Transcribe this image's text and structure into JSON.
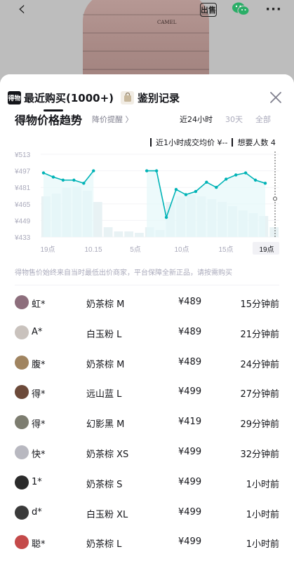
{
  "backdrop": {
    "jacket_logo": "CAMEL",
    "sell_badge": "出售"
  },
  "tabs": [
    {
      "label": "最近购买(1000+)",
      "icon": "dewu-logo-icon",
      "icon_text": "得物"
    },
    {
      "label": "鉴别记录",
      "icon": "shopping-bag-icon"
    }
  ],
  "trend": {
    "title": "得物价格趋势",
    "alert": "降价提醒 〉",
    "ranges": [
      "近24小时",
      "30天",
      "全部"
    ]
  },
  "info": {
    "last_hour": "近1小时成交均价 ¥--",
    "wanted": "想要人数 4"
  },
  "chart_data": {
    "type": "line",
    "y_ticks": [
      "¥513",
      "¥497",
      "¥481",
      "¥465",
      "¥449",
      "¥433"
    ],
    "x_ticks": [
      "19点",
      "10.15",
      "5点",
      "10点",
      "15点",
      "19点"
    ],
    "ylim": [
      433,
      513
    ],
    "price_series": [
      {
        "x": 0.0,
        "y": 495
      },
      {
        "x": 0.9,
        "y": 491
      },
      {
        "x": 1.8,
        "y": 488
      },
      {
        "x": 2.8,
        "y": 488
      },
      {
        "x": 3.7,
        "y": 485
      },
      {
        "x": 4.6,
        "y": 497
      },
      {
        "x": 9.5,
        "y": 497
      },
      {
        "x": 10.4,
        "y": 497
      },
      {
        "x": 11.3,
        "y": 452
      },
      {
        "x": 12.2,
        "y": 479
      },
      {
        "x": 13.1,
        "y": 474
      },
      {
        "x": 14.0,
        "y": 477
      },
      {
        "x": 15.0,
        "y": 486
      },
      {
        "x": 15.9,
        "y": 481
      },
      {
        "x": 16.8,
        "y": 489
      },
      {
        "x": 17.7,
        "y": 493
      },
      {
        "x": 18.6,
        "y": 495
      },
      {
        "x": 19.5,
        "y": 488
      },
      {
        "x": 20.4,
        "y": 485
      }
    ],
    "volume_bars": [
      58,
      62,
      70,
      72,
      66,
      50,
      14,
      8,
      8,
      6,
      14,
      10,
      50,
      58,
      60,
      58,
      54,
      50,
      44,
      38,
      34,
      30,
      14
    ],
    "colors": {
      "line": "#00b3b6",
      "bar": "#e8f2f4",
      "area": "#e6f8f9"
    }
  },
  "footnote": "得物售价始终来自当时最低出价商家，平台保障全新正品，请按需购买",
  "transactions": [
    {
      "name": "虹*",
      "spec": "奶茶棕 M",
      "price": "¥489",
      "time": "15分钟前",
      "avatar": "#8d6e7c"
    },
    {
      "name": "A*",
      "spec": "白玉粉 L",
      "price": "¥489",
      "time": "21分钟前",
      "avatar": "#c9c2bd"
    },
    {
      "name": "腹*",
      "spec": "奶茶棕 M",
      "price": "¥489",
      "time": "24分钟前",
      "avatar": "#a08460"
    },
    {
      "name": "得*",
      "spec": "远山蓝 L",
      "price": "¥499",
      "time": "27分钟前",
      "avatar": "#6c4a3a"
    },
    {
      "name": "得*",
      "spec": "幻影黑 M",
      "price": "¥419",
      "time": "29分钟前",
      "avatar": "#7d7d70"
    },
    {
      "name": "快*",
      "spec": "奶茶棕 XS",
      "price": "¥499",
      "time": "32分钟前",
      "avatar": "#b8b8c0"
    },
    {
      "name": "1*",
      "spec": "奶茶棕 S",
      "price": "¥499",
      "time": "1小时前",
      "avatar": "#2b2b2b"
    },
    {
      "name": "d*",
      "spec": "白玉粉 XL",
      "price": "¥499",
      "time": "1小时前",
      "avatar": "#3a3a3a"
    },
    {
      "name": "聪*",
      "spec": "奶茶棕 L",
      "price": "¥499",
      "time": "1小时前",
      "avatar": "#c44a4a"
    }
  ]
}
